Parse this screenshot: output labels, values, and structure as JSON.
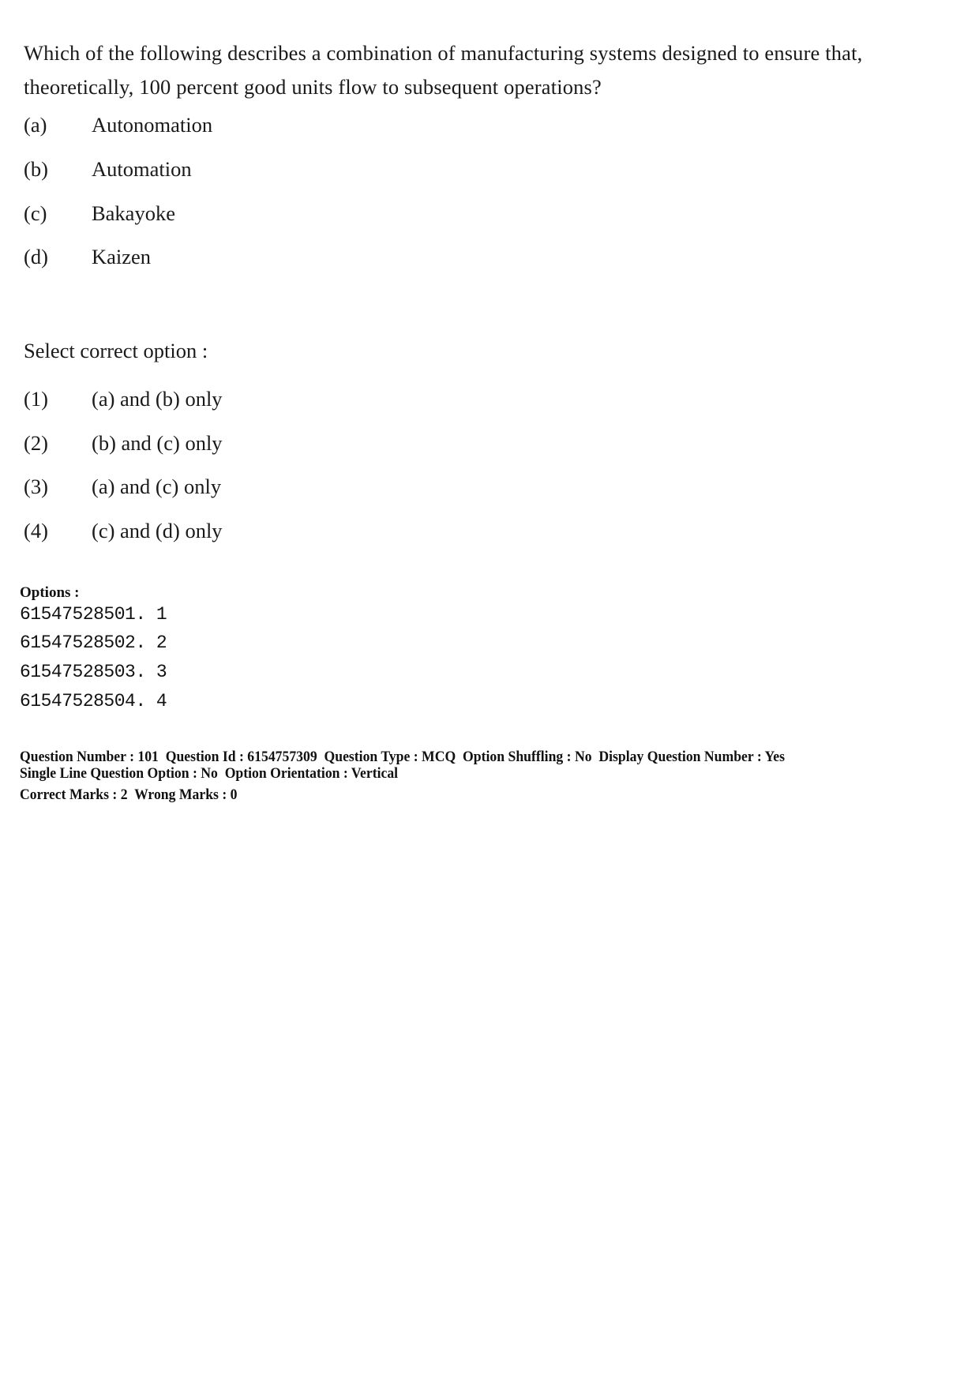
{
  "question": {
    "text": "Which of the following describes a combination of manufacturing systems designed to ensure that, theoretically, 100 percent good units flow to subsequent operations?",
    "statements": [
      {
        "label": "(a)",
        "text": "Autonomation"
      },
      {
        "label": "(b)",
        "text": "Automation"
      },
      {
        "label": "(c)",
        "text": "Bakayoke"
      },
      {
        "label": "(d)",
        "text": "Kaizen"
      }
    ],
    "select_prompt": "Select correct option :",
    "choices": [
      {
        "label": "(1)",
        "text": "(a) and (b) only"
      },
      {
        "label": "(2)",
        "text": "(b) and (c) only"
      },
      {
        "label": "(3)",
        "text": "(a) and (c) only"
      },
      {
        "label": "(4)",
        "text": "(c) and (d) only"
      }
    ]
  },
  "options": {
    "heading": "Options :",
    "items": [
      "61547528501. 1",
      "61547528502. 2",
      "61547528503. 3",
      "61547528504. 4"
    ]
  },
  "next_question_meta": {
    "line1": "Question Number : 101  Question Id : 6154757309  Question Type : MCQ  Option Shuffling : No  Display Question Number : Yes",
    "line2": "Single Line Question Option : No  Option Orientation : Vertical",
    "line3": "Correct Marks : 2  Wrong Marks : 0"
  }
}
